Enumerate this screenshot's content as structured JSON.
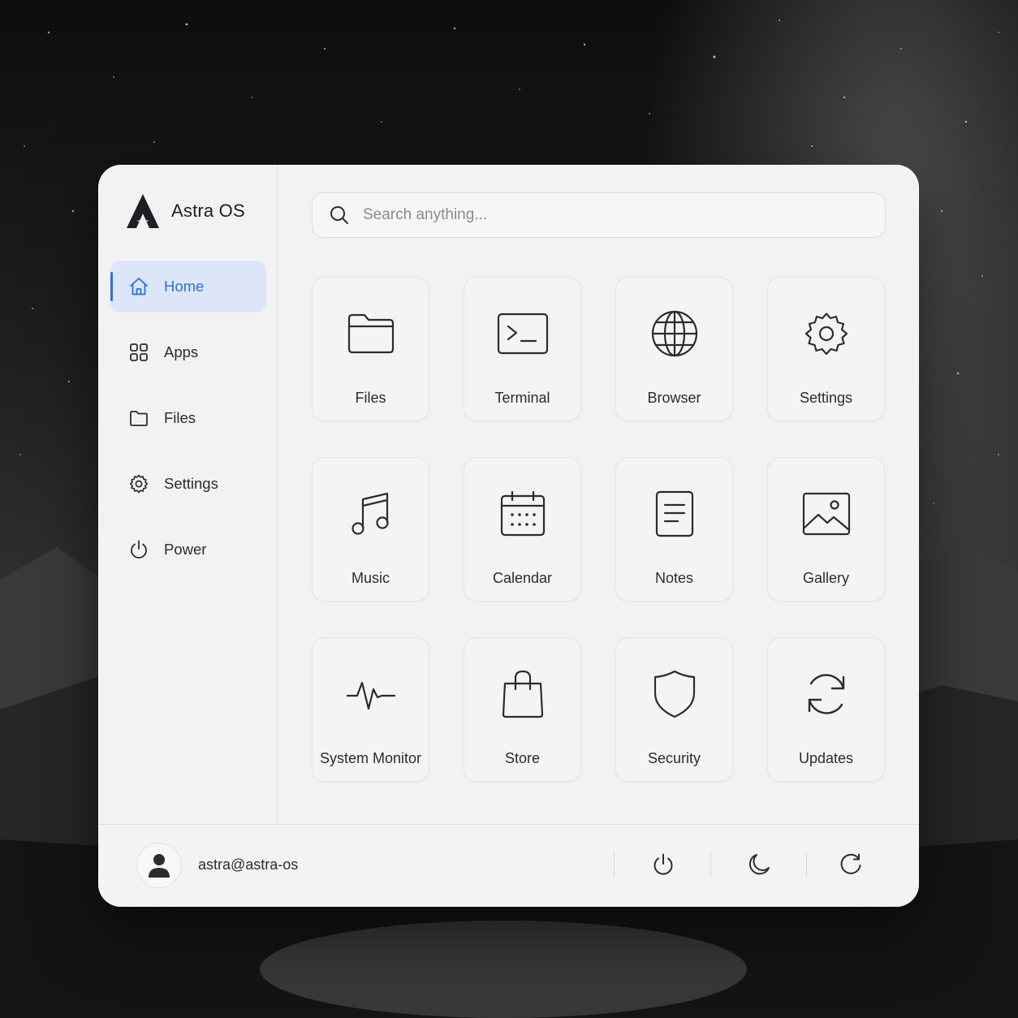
{
  "app": {
    "name": "Astra OS",
    "logo_icon": "astra-logo-icon"
  },
  "accent_color": "#2e6fe4",
  "sidebar": {
    "items": [
      {
        "label": "Home",
        "icon": "home-icon",
        "active": true
      },
      {
        "label": "Apps",
        "icon": "apps-grid-icon",
        "active": false
      },
      {
        "label": "Files",
        "icon": "folder-icon",
        "active": false
      },
      {
        "label": "Settings",
        "icon": "gear-icon",
        "active": false
      },
      {
        "label": "Power",
        "icon": "power-icon",
        "active": false
      }
    ]
  },
  "search": {
    "placeholder": "Search anything...",
    "value": ""
  },
  "apps": [
    {
      "label": "Files",
      "icon": "folder-icon"
    },
    {
      "label": "Terminal",
      "icon": "terminal-icon"
    },
    {
      "label": "Browser",
      "icon": "globe-icon"
    },
    {
      "label": "Settings",
      "icon": "gear-icon"
    },
    {
      "label": "Music",
      "icon": "music-note-icon"
    },
    {
      "label": "Calendar",
      "icon": "calendar-icon"
    },
    {
      "label": "Notes",
      "icon": "notes-icon"
    },
    {
      "label": "Gallery",
      "icon": "image-icon"
    },
    {
      "label": "System Monitor",
      "icon": "pulse-icon"
    },
    {
      "label": "Store",
      "icon": "shopping-bag-icon"
    },
    {
      "label": "Security",
      "icon": "shield-icon"
    },
    {
      "label": "Updates",
      "icon": "refresh-icon"
    }
  ],
  "footer": {
    "user": "astra@astra-os",
    "avatar_icon": "user-icon",
    "actions": [
      {
        "name": "power",
        "icon": "power-icon"
      },
      {
        "name": "sleep",
        "icon": "moon-icon"
      },
      {
        "name": "restart",
        "icon": "restart-icon"
      }
    ]
  }
}
